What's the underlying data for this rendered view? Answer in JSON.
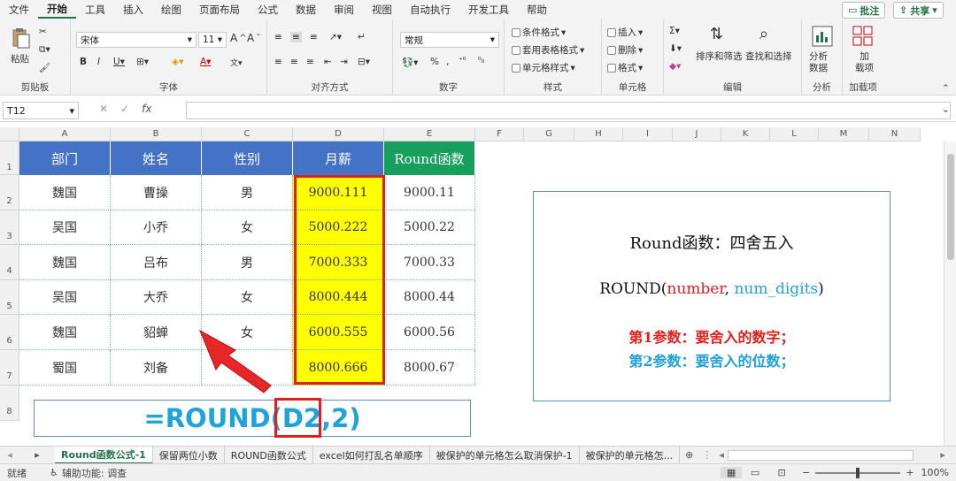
{
  "menu": {
    "items": [
      "文件",
      "开始",
      "工具",
      "插入",
      "绘图",
      "页面布局",
      "公式",
      "数据",
      "审阅",
      "视图",
      "自动执行",
      "开发工具",
      "帮助"
    ],
    "active": "开始",
    "comment_btn": "批注",
    "share_btn": "共享"
  },
  "ribbon": {
    "clipboard": {
      "paste": "粘贴",
      "label": "剪贴板"
    },
    "font": {
      "name": "宋体",
      "size": "11",
      "label": "字体"
    },
    "align": {
      "label": "对齐方式"
    },
    "number": {
      "format": "常规",
      "label": "数字"
    },
    "styles": {
      "cond": "条件格式",
      "table": "套用表格格式",
      "cell": "单元格样式",
      "label": "样式"
    },
    "cells": {
      "insert": "插入",
      "delete": "删除",
      "format": "格式",
      "label": "单元格"
    },
    "edit": {
      "sort": "排序和筛选",
      "find": "查找和选择",
      "label": "编辑"
    },
    "analysis": {
      "btn": "分析\n数据",
      "label": "分析"
    },
    "addin": {
      "btn": "加\n载项",
      "label": "加载项"
    }
  },
  "formula_bar": {
    "name_box": "T12",
    "fx": "fx",
    "value": ""
  },
  "columns": [
    "A",
    "B",
    "C",
    "D",
    "E",
    "F",
    "G",
    "H",
    "I",
    "J",
    "K",
    "L",
    "M",
    "N"
  ],
  "rows": [
    "1",
    "2",
    "3",
    "4",
    "5",
    "6",
    "7",
    "8"
  ],
  "table": {
    "headers": [
      "部门",
      "姓名",
      "性别",
      "月薪",
      "Round函数"
    ],
    "data": [
      [
        "魏国",
        "曹操",
        "男",
        "9000.111",
        "9000.11"
      ],
      [
        "吴国",
        "小乔",
        "女",
        "5000.222",
        "5000.22"
      ],
      [
        "魏国",
        "吕布",
        "男",
        "7000.333",
        "7000.33"
      ],
      [
        "吴国",
        "大乔",
        "女",
        "8000.444",
        "8000.44"
      ],
      [
        "魏国",
        "貂蝉",
        "女",
        "6000.555",
        "6000.56"
      ],
      [
        "蜀国",
        "刘备",
        "",
        "8000.666",
        "8000.67"
      ]
    ]
  },
  "info_box": {
    "title": "Round函数：四舍五入",
    "syntax_fn": "ROUND(",
    "syntax_arg1": "number",
    "syntax_sep": ", ",
    "syntax_arg2": "num_digits",
    "syntax_end": ")",
    "param1": "第1参数：要舍入的数字；",
    "param2": "第2参数：要舍入的位数；"
  },
  "formula_display": {
    "prefix": "=ROUND(",
    "ref": "D2",
    "suffix": ",2)"
  },
  "sheets": [
    "Round函数公式-1",
    "保留两位小数",
    "ROUND函数公式",
    "excel如何打乱名单顺序",
    "被保护的单元格怎么取消保护-1",
    "被保护的单元格怎..."
  ],
  "status": {
    "ready": "就绪",
    "accessibility": "辅助功能: 调查",
    "zoom": "100%"
  },
  "colors": {
    "header_blue": "#4472c4",
    "header_green": "#17a05d",
    "highlight": "#ffff00",
    "red": "#e02020",
    "cyan": "#1fa3db"
  }
}
